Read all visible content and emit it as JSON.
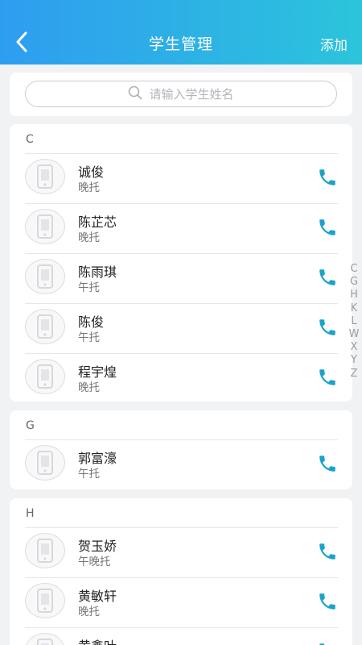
{
  "header": {
    "title": "学生管理",
    "add_label": "添加"
  },
  "search": {
    "placeholder": "请输入学生姓名"
  },
  "groups": [
    {
      "letter": "C",
      "students": [
        {
          "name": "诚俊",
          "service": "晚托"
        },
        {
          "name": "陈芷芯",
          "service": "晚托"
        },
        {
          "name": "陈雨琪",
          "service": "午托"
        },
        {
          "name": "陈俊",
          "service": "午托"
        },
        {
          "name": "程宇煌",
          "service": "晚托"
        }
      ]
    },
    {
      "letter": "G",
      "students": [
        {
          "name": "郭富濠",
          "service": "午托"
        }
      ]
    },
    {
      "letter": "H",
      "students": [
        {
          "name": "贺玉娇",
          "service": "午晚托"
        },
        {
          "name": "黄敏轩",
          "service": "晚托"
        },
        {
          "name": "黄鑫叶",
          "service": ""
        }
      ]
    }
  ],
  "index_letters": [
    "C",
    "G",
    "H",
    "K",
    "L",
    "W",
    "X",
    "Y",
    "Z"
  ],
  "colors": {
    "header_start": "#2e9df0",
    "header_end": "#2cc4db",
    "phone_icon": "#1aa3c9"
  }
}
